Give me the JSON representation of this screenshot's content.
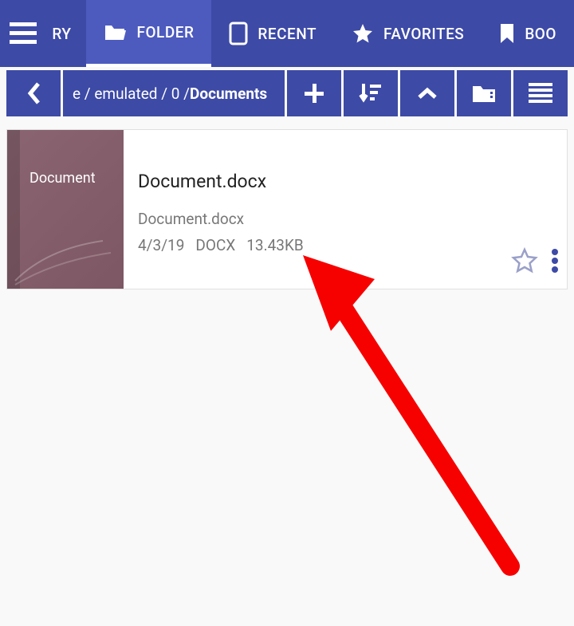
{
  "tabs": {
    "partial_left": "RY",
    "folder": "FOLDER",
    "recent": "RECENT",
    "favorites": "FAVORITES",
    "bookmarks": "BOO"
  },
  "breadcrumb": {
    "path_prefix": "e / emulated / 0 / ",
    "current": "Documents"
  },
  "file": {
    "thumb_label": "Document",
    "title": "Document.docx",
    "subtitle": "Document.docx",
    "date": "4/3/19",
    "type": "DOCX",
    "size": "13.43KB"
  }
}
